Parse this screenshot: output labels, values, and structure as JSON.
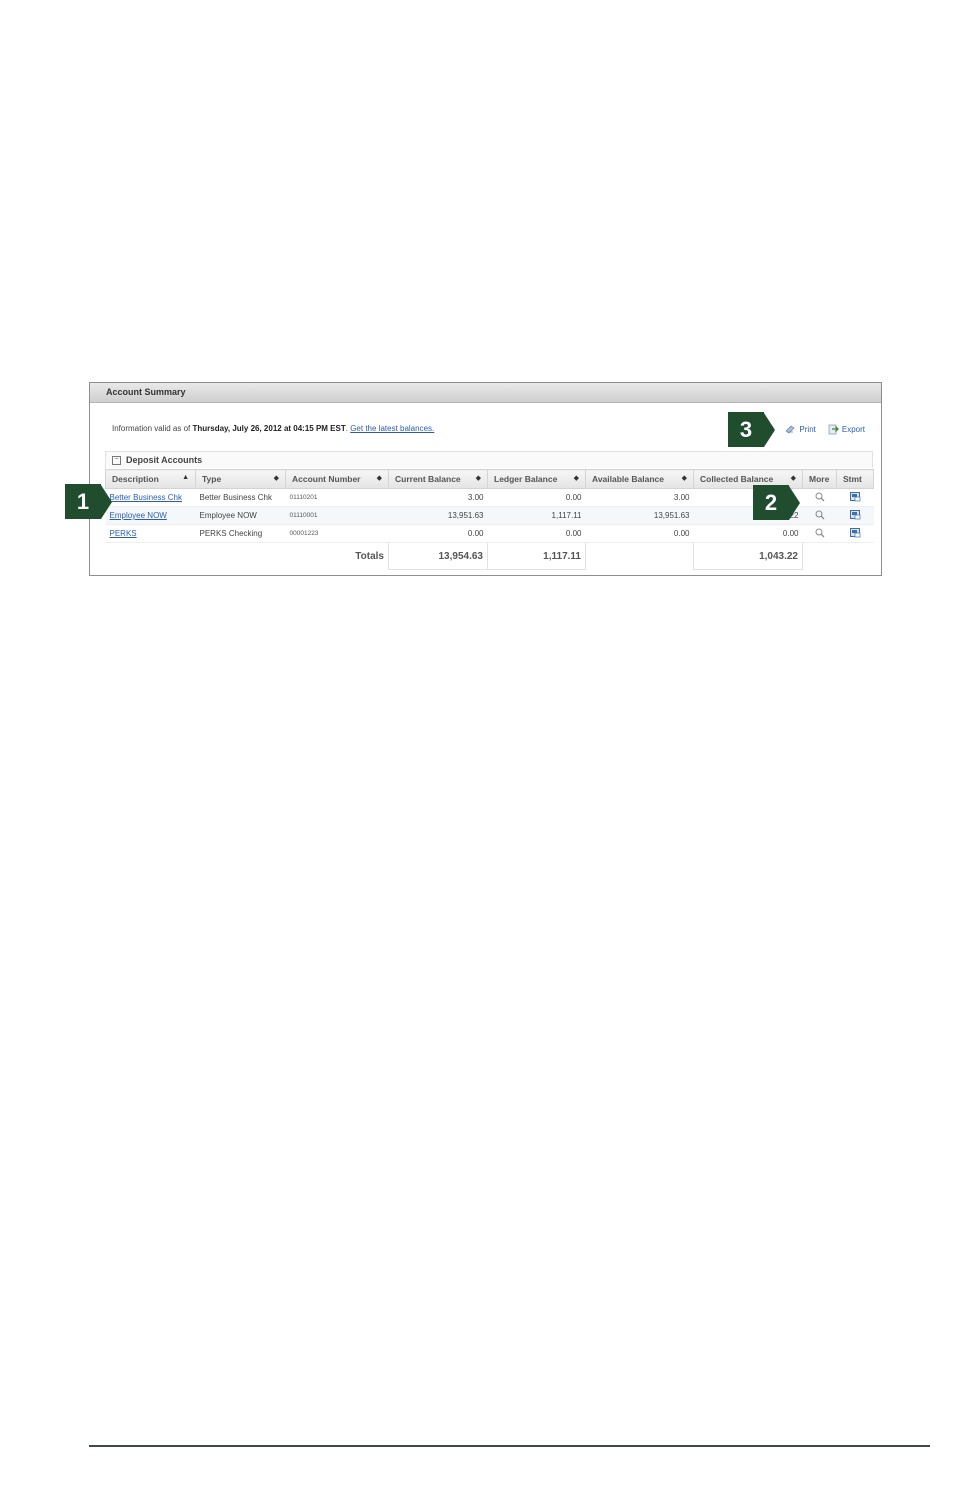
{
  "panel": {
    "title": "Account Summary",
    "info_prefix": "Information valid as of ",
    "info_date": "Thursday, July 26, 2012 at 04:15 PM EST",
    "info_sep": ". ",
    "latest_link": "Get the latest balances.",
    "print_label": "Print",
    "export_label": "Export",
    "section_title": "Deposit Accounts",
    "section_toggle": "−"
  },
  "table": {
    "columns": [
      "Description",
      "Type",
      "Account Number",
      "Current Balance",
      "Ledger Balance",
      "Available Balance",
      "Collected Balance",
      "More",
      "Stmt"
    ],
    "sort_asc": "▲",
    "sort_both": "◆",
    "rows": [
      {
        "description": "Better Business Chk",
        "type": "Better Business Chk",
        "account": "01110201",
        "current": "3.00",
        "ledger": "0.00",
        "available": "3.00",
        "collected": ""
      },
      {
        "description": "Employee NOW",
        "type": "Employee NOW",
        "account": "01110001",
        "current": "13,951.63",
        "ledger": "1,117.11",
        "available": "13,951.63",
        "collected": ".22"
      },
      {
        "description": "PERKS",
        "type": "PERKS Checking",
        "account": "00001223",
        "current": "0.00",
        "ledger": "0.00",
        "available": "0.00",
        "collected": "0.00"
      }
    ],
    "totals": {
      "label": "Totals",
      "current": "13,954.63",
      "ledger": "1,117.11",
      "collected": "1,043.22"
    }
  },
  "badges": [
    "1",
    "2",
    "3"
  ],
  "colors": {
    "badge": "#1f4d2e",
    "link": "#2a5db0"
  },
  "icons": {
    "more": "magnifier-icon",
    "stmt": "statement-icon",
    "print": "print-icon",
    "export": "export-icon"
  }
}
